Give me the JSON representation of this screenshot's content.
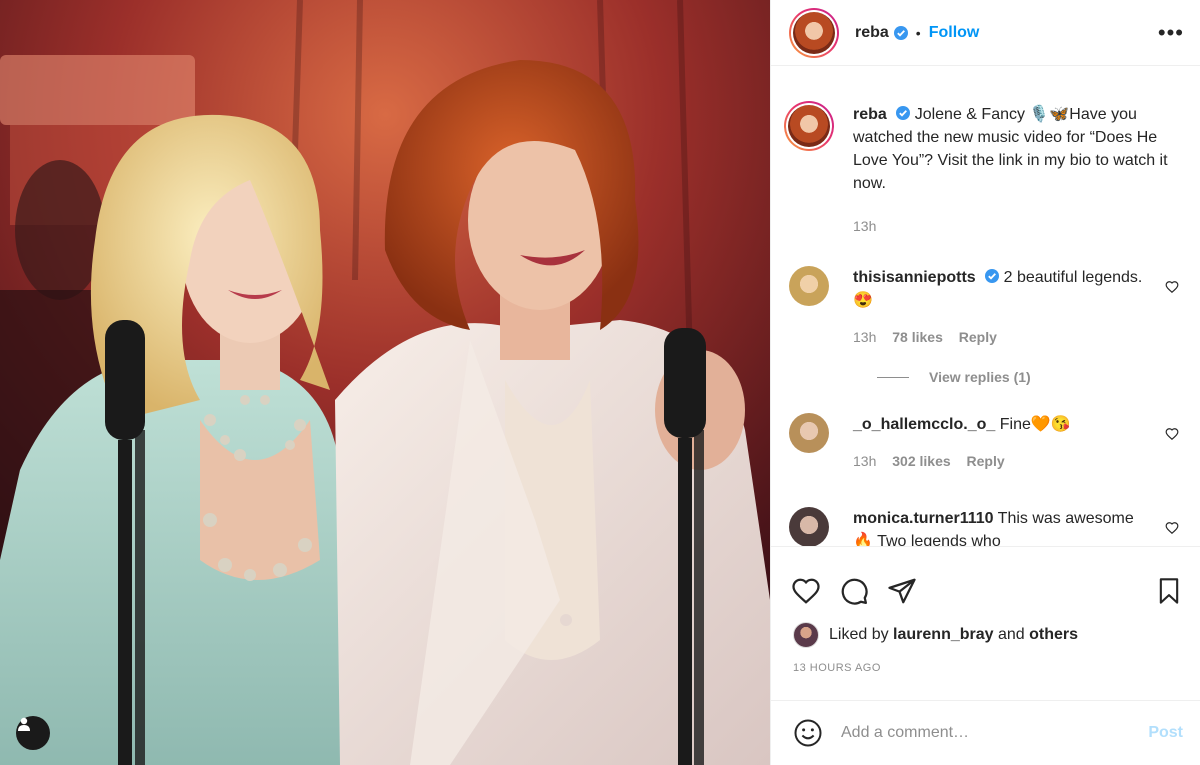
{
  "post": {
    "username": "reba",
    "follow_label": "Follow",
    "more_label": "•••",
    "separator": "•"
  },
  "caption": {
    "username": "reba",
    "text": "Jolene & Fancy 🎙️🦋Have you watched the new music video for “Does He Love You”? Visit the link in my bio to watch it now.",
    "time": "13h"
  },
  "comments": [
    {
      "username": "thisisanniepotts",
      "verified": true,
      "text": "2 beautiful legends. 😍",
      "time": "13h",
      "likes": "78 likes",
      "reply": "Reply",
      "view_replies": "View replies (1)"
    },
    {
      "username": "_o_hallemcclo._o_",
      "verified": false,
      "text": "Fine🧡😘",
      "time": "13h",
      "likes": "302 likes",
      "reply": "Reply"
    },
    {
      "username": "monica.turner1110",
      "verified": false,
      "text": "This was awesome 🔥 Two legends who"
    }
  ],
  "liked_by": {
    "prefix": "Liked by",
    "user": "laurenn_bray",
    "conj": "and",
    "others": "others"
  },
  "timestamp": "13 HOURS AGO",
  "add_comment": {
    "placeholder": "Add a comment…",
    "post_label": "Post"
  },
  "icons": {
    "like": "heart-icon",
    "comment": "comment-icon",
    "share": "send-icon",
    "save": "bookmark-icon",
    "emoji": "emoji-icon",
    "tag": "user-tag-icon"
  },
  "colors": {
    "link_blue": "#0095f6",
    "post_disabled": "#b2dffc",
    "secondary_text": "#8e8e8e"
  }
}
